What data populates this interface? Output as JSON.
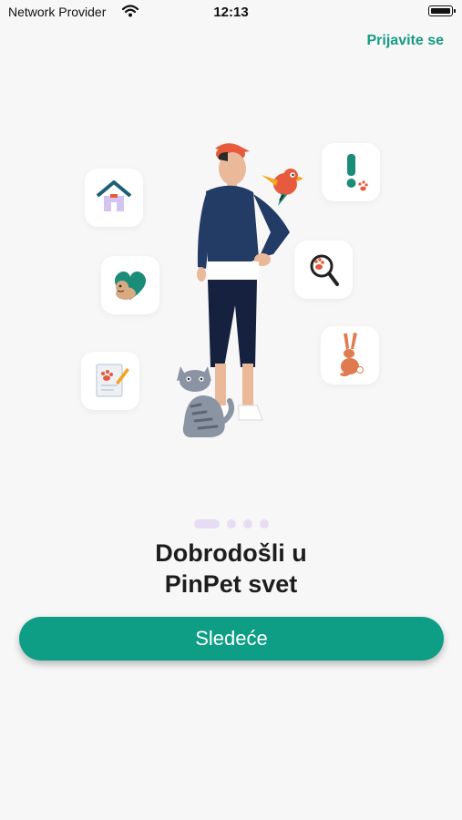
{
  "status_bar": {
    "carrier": "Network Provider",
    "time": "12:13",
    "wifi_icon": "wifi-icon",
    "battery_icon": "battery-icon"
  },
  "header": {
    "login_label": "Prijavite se"
  },
  "illustration": {
    "icons": [
      "house-icon",
      "heart-dog-icon",
      "document-paw-icon",
      "exclamation-paw-icon",
      "magnifier-paw-icon",
      "rabbit-icon",
      "person-illustration",
      "parrot-icon",
      "cat-icon"
    ]
  },
  "pager": {
    "total": 4,
    "active_index": 0
  },
  "welcome": {
    "title_line1": "Dobrodošli u",
    "title_line2": "PinPet svet"
  },
  "actions": {
    "next_label": "Sledeće"
  },
  "colors": {
    "accent": "#0e9e85",
    "link": "#169b84",
    "pager_dot": "#e6ddf4",
    "background": "#f7f7f7"
  }
}
